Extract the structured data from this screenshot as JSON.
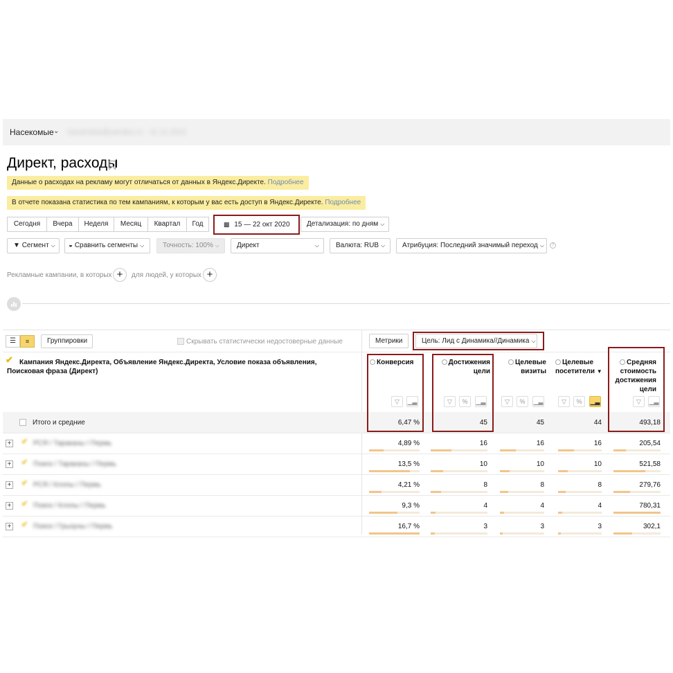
{
  "topbar": {
    "counter_name": "Насекомые",
    "blurred": "kazanskie@yandex.ru · 11 11 2021"
  },
  "page": {
    "title": "Директ, расходы"
  },
  "notices": [
    {
      "text": "Данные о расходах на рекламу могут отличаться от данных в Яндекс.Директе.",
      "link": "Подробнее"
    },
    {
      "text": "В отчете показана статистика по тем кампаниям, к которым у вас есть доступ в Яндекс.Директе.",
      "link": "Подробнее"
    }
  ],
  "periods": [
    "Сегодня",
    "Вчера",
    "Неделя",
    "Месяц",
    "Квартал",
    "Год"
  ],
  "date_range": "15 — 22 окт 2020",
  "detail": "Детализация: по дням",
  "filters": {
    "segment": "Сегмент",
    "compare": "Сравнить сегменты",
    "accuracy": "Точность: 100%",
    "source": "Директ",
    "currency": "Валюта: RUB",
    "attribution": "Атрибуция: Последний значимый переход"
  },
  "builder": {
    "text1": "Рекламные кампании, в которых",
    "text2": "для людей, у которых"
  },
  "table_toolbar": {
    "groupings": "Группировки",
    "hide_unreliable": "Скрывать статистически недостоверные данные",
    "metrics": "Метрики",
    "goal": "Цель: Лид с Динамика//Динамика"
  },
  "dimension_header": "Кампания Яндекс.Директа, Объявление Яндекс.Директа, Условие показа объявления, Поисковая фраза (Директ)",
  "columns": [
    {
      "label": "Конверсия"
    },
    {
      "label": "Достижения цели"
    },
    {
      "label": "Целевые визиты"
    },
    {
      "label": "Целевые посетители",
      "sort": "▼"
    },
    {
      "label": "Средняя стоимость достижения цели"
    }
  ],
  "totals": {
    "label": "Итого и средние",
    "values": [
      "6,47 %",
      "45",
      "45",
      "44",
      "493,18"
    ]
  },
  "rows": [
    {
      "name": "РСЯ / Тараканы / Пермь",
      "values": [
        "4,89 %",
        "16",
        "16",
        "16",
        "205,54"
      ],
      "share": [
        0.29,
        0.36,
        0.36,
        0.36,
        0.26
      ]
    },
    {
      "name": "Поиск / Тараканы / Пермь",
      "values": [
        "13,5 %",
        "10",
        "10",
        "10",
        "521,58"
      ],
      "share": [
        0.81,
        0.22,
        0.22,
        0.23,
        0.67
      ]
    },
    {
      "name": "РСЯ / Клопы / Пермь",
      "values": [
        "4,21 %",
        "8",
        "8",
        "8",
        "279,76"
      ],
      "share": [
        0.25,
        0.18,
        0.18,
        0.18,
        0.36
      ]
    },
    {
      "name": "Поиск / Клопы / Пермь",
      "values": [
        "9,3 %",
        "4",
        "4",
        "4",
        "780,31"
      ],
      "share": [
        0.56,
        0.09,
        0.09,
        0.09,
        1.0
      ]
    },
    {
      "name": "Поиск / Грызуны / Пермь",
      "values": [
        "16,7 %",
        "3",
        "3",
        "3",
        "302,1"
      ],
      "share": [
        1.0,
        0.07,
        0.07,
        0.07,
        0.39
      ]
    }
  ],
  "colors": {
    "accent_red": "#8b1a1a",
    "notice_bg": "#fbeda0",
    "bar": "#f1c58a",
    "check": "#e8b80e"
  }
}
